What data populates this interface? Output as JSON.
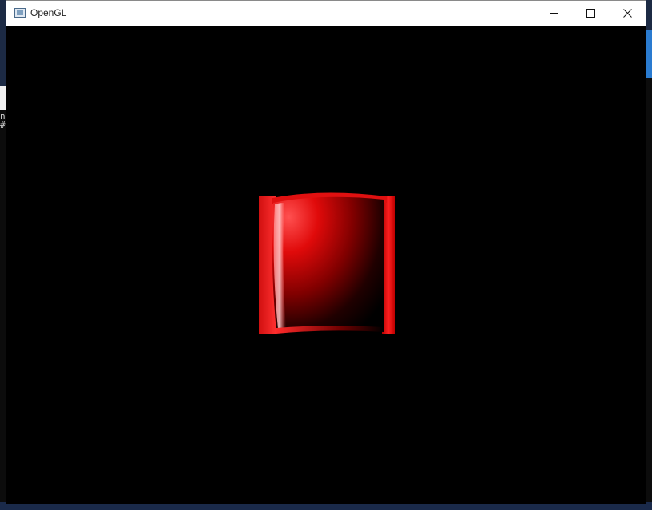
{
  "window": {
    "title": "OpenGL"
  },
  "background": {
    "console_glyphs": "n\n#"
  },
  "scene": {
    "object": "red-cylinder-shape",
    "background_color": "#000000",
    "object_color": "#cc0000"
  },
  "icons": {
    "app": "opengl-window-icon",
    "minimize": "minimize-icon",
    "maximize": "maximize-icon",
    "close": "close-icon"
  }
}
